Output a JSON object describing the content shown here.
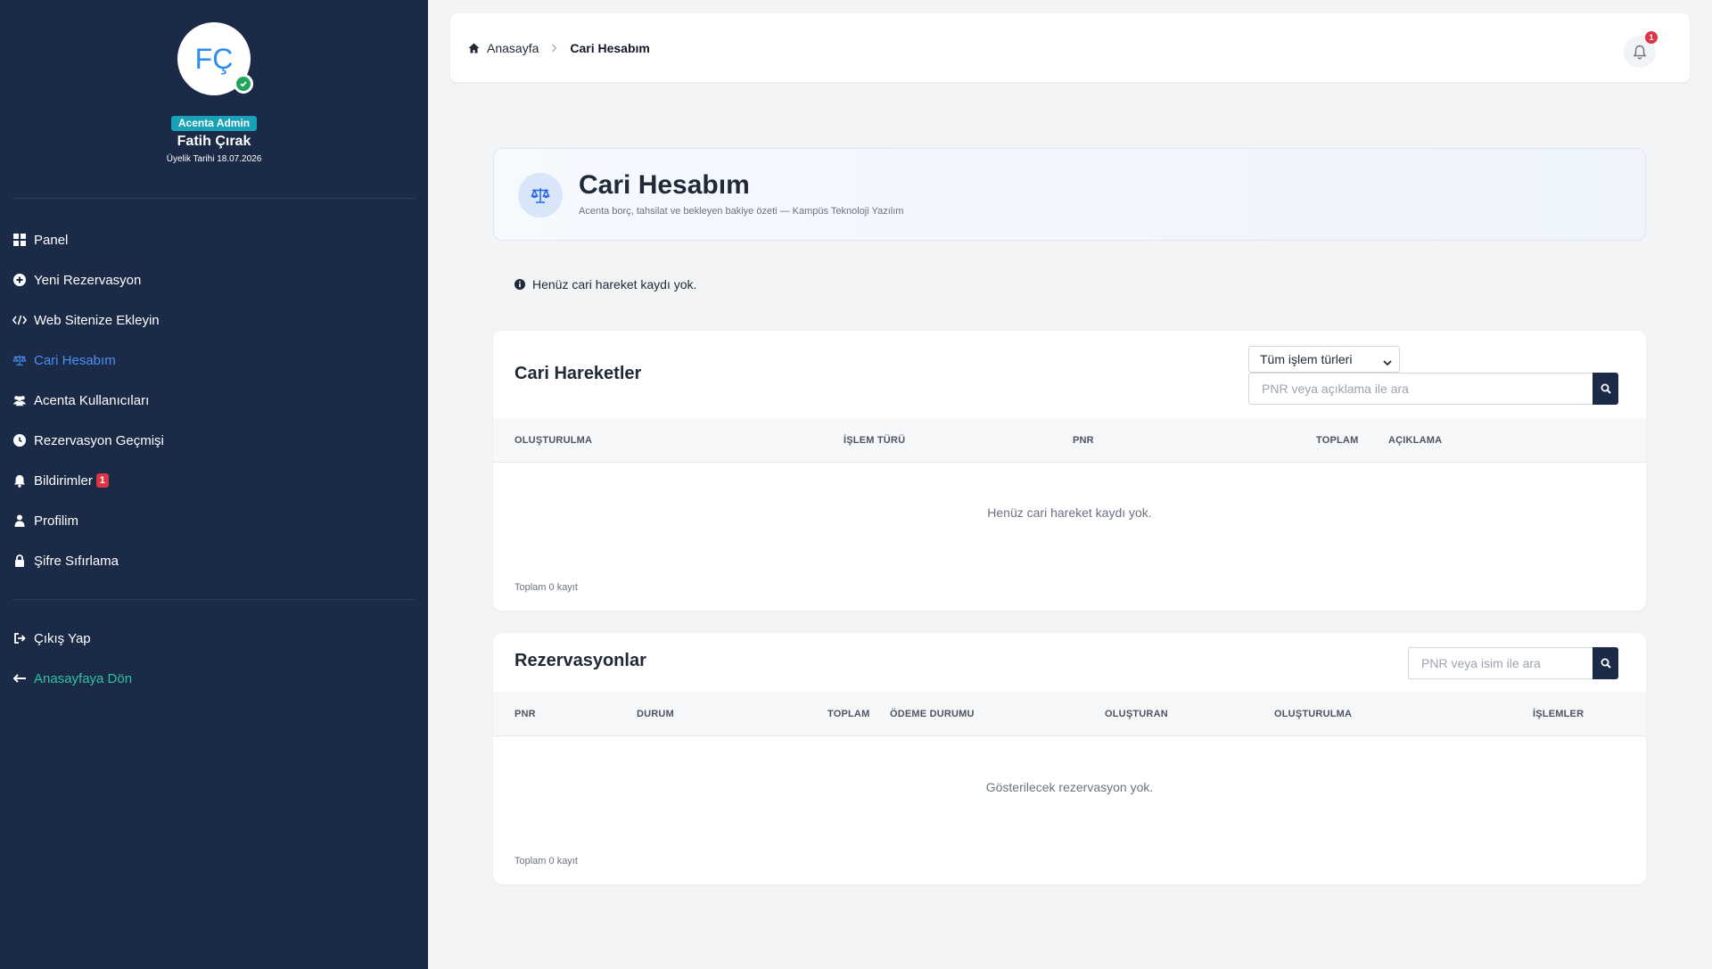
{
  "user": {
    "initials": "FÇ",
    "role": "Acenta Admin",
    "name": "Fatih Çırak",
    "member_since": "Üyelik Tarihi 18.07.2026"
  },
  "sidebar": {
    "items": [
      {
        "label": "Panel",
        "icon": "dashboard-icon"
      },
      {
        "label": "Yeni Rezervasyon",
        "icon": "plus-circle-icon"
      },
      {
        "label": "Web Sitenize Ekleyin",
        "icon": "code-icon"
      },
      {
        "label": "Cari Hesabım",
        "icon": "balance-scale-icon",
        "active": true
      },
      {
        "label": "Acenta Kullanıcıları",
        "icon": "users-icon"
      },
      {
        "label": "Rezervasyon Geçmişi",
        "icon": "clock-icon"
      },
      {
        "label": "Bildirimler",
        "icon": "bell-icon",
        "badge": "1"
      },
      {
        "label": "Profilim",
        "icon": "user-icon"
      },
      {
        "label": "Şifre Sıfırlama",
        "icon": "lock-icon"
      }
    ],
    "logout": {
      "label": "Çıkış Yap",
      "icon": "sign-out-icon"
    },
    "home": {
      "label": "Anasayfaya Dön",
      "icon": "arrow-left-icon"
    }
  },
  "topbar": {
    "breadcrumb": {
      "home": "Anasayfa",
      "current": "Cari Hesabım"
    },
    "notification_count": "1"
  },
  "page_header": {
    "title": "Cari Hesabım",
    "subtitle": "Acenta borç, tahsilat ve bekleyen bakiye özeti — Kampüs Teknoloji Yazılım"
  },
  "info_message": "Henüz cari hareket kaydı yok.",
  "transactions": {
    "title": "Cari Hareketler",
    "filter_selected": "Tüm işlem türleri",
    "search_placeholder": "PNR veya açıklama ile ara",
    "columns": [
      "OLUŞTURULMA",
      "İŞLEM TÜRÜ",
      "PNR",
      "TOPLAM",
      "AÇIKLAMA"
    ],
    "empty_message": "Henüz cari hareket kaydı yok.",
    "total_text": "Toplam 0 kayıt"
  },
  "reservations": {
    "title": "Rezervasyonlar",
    "search_placeholder": "PNR veya isim ile ara",
    "columns": [
      "PNR",
      "DURUM",
      "TOPLAM",
      "ÖDEME DURUMU",
      "OLUŞTURAN",
      "OLUŞTURULMA",
      "İŞLEMLER"
    ],
    "empty_message": "Gösterilecek rezervasyon yok.",
    "total_text": "Toplam 0 kayıt"
  },
  "colors": {
    "sidebar_bg": "#1b2a47",
    "active_nav": "#4a90f2",
    "home_link": "#2fc3a0",
    "role_badge": "#17a2b8",
    "danger": "#dc3545",
    "success": "#22a55b"
  }
}
